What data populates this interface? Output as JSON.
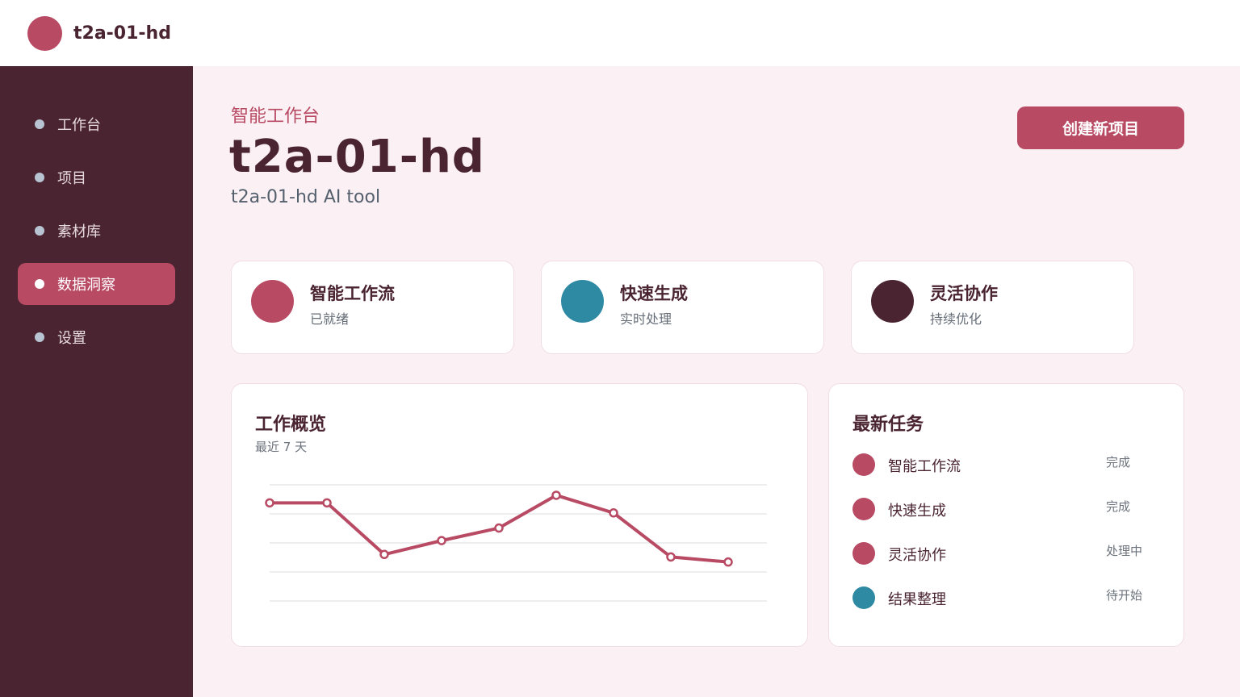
{
  "app": {
    "title": "t2a-01-hd",
    "brand_color": "#b84a64"
  },
  "sidebar": {
    "items": [
      {
        "label": "工作台",
        "active": false
      },
      {
        "label": "项目",
        "active": false
      },
      {
        "label": "素材库",
        "active": false
      },
      {
        "label": "数据洞察",
        "active": true
      },
      {
        "label": "设置",
        "active": false
      }
    ]
  },
  "header": {
    "eyebrow": "智能工作台",
    "title": "t2a-01-hd",
    "subtitle": "t2a-01-hd AI tool",
    "create_button": "创建新项目"
  },
  "features": [
    {
      "title": "智能工作流",
      "sub": "已就绪",
      "color": "#b84a64"
    },
    {
      "title": "快速生成",
      "sub": "实时处理",
      "color": "#2e89a3"
    },
    {
      "title": "灵活协作",
      "sub": "持续优化",
      "color": "#4a2430"
    }
  ],
  "overview": {
    "title": "工作概览",
    "subtitle": "最近 7 天",
    "chart_data": {
      "type": "line",
      "series": [
        {
          "values": [
            78,
            78,
            37,
            48,
            58,
            84,
            70,
            35,
            31
          ]
        }
      ],
      "ylim": [
        0,
        100
      ],
      "grid": true,
      "color": "#b84a64"
    }
  },
  "tasks": {
    "title": "最新任务",
    "items": [
      {
        "name": "智能工作流",
        "status": "完成",
        "color": "#b84a64"
      },
      {
        "name": "快速生成",
        "status": "完成",
        "color": "#b84a64"
      },
      {
        "name": "灵活协作",
        "status": "处理中",
        "color": "#b84a64"
      },
      {
        "name": "结果整理",
        "status": "待开始",
        "color": "#2e89a3"
      }
    ]
  }
}
